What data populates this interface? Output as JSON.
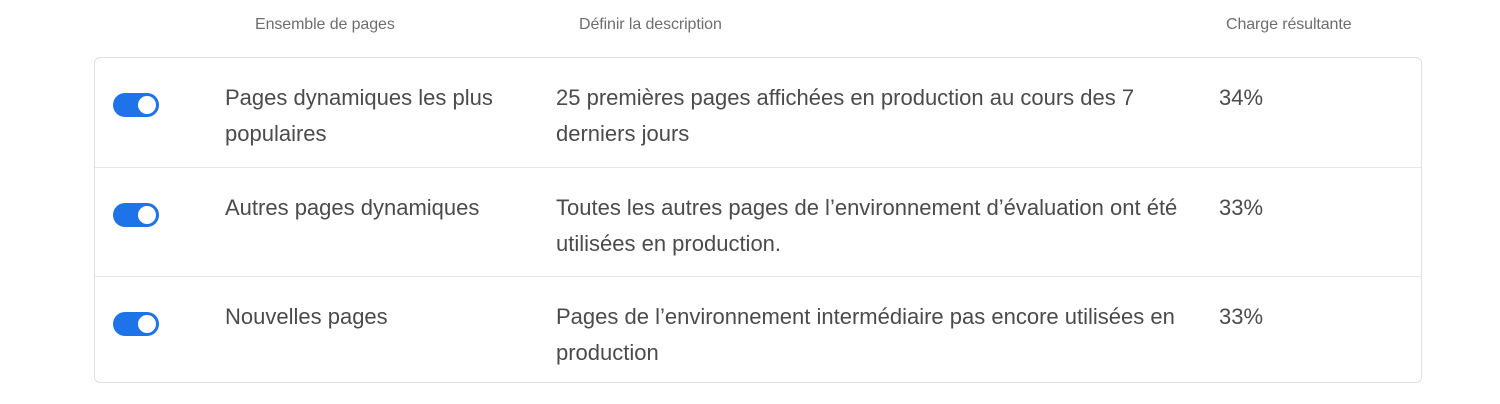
{
  "columns": {
    "page_set": "Ensemble de pages",
    "description": "Définir la description",
    "resulting_load": "Charge résultante"
  },
  "rows": [
    {
      "enabled": true,
      "page_set": "Pages dynamiques les plus populaires",
      "description": "25 premières pages affichées en production au cours des 7 derniers jours",
      "load": "34%"
    },
    {
      "enabled": true,
      "page_set": "Autres pages dynamiques",
      "description": "Toutes les autres pages de l’environnement d’évaluation ont été utilisées en production.",
      "load": "33%"
    },
    {
      "enabled": true,
      "page_set": "Nouvelles pages",
      "description": "Pages de l’environnement intermédiaire pas encore utilisées en production",
      "load": "33%"
    }
  ],
  "colors": {
    "toggle_on": "#1f73e8"
  }
}
